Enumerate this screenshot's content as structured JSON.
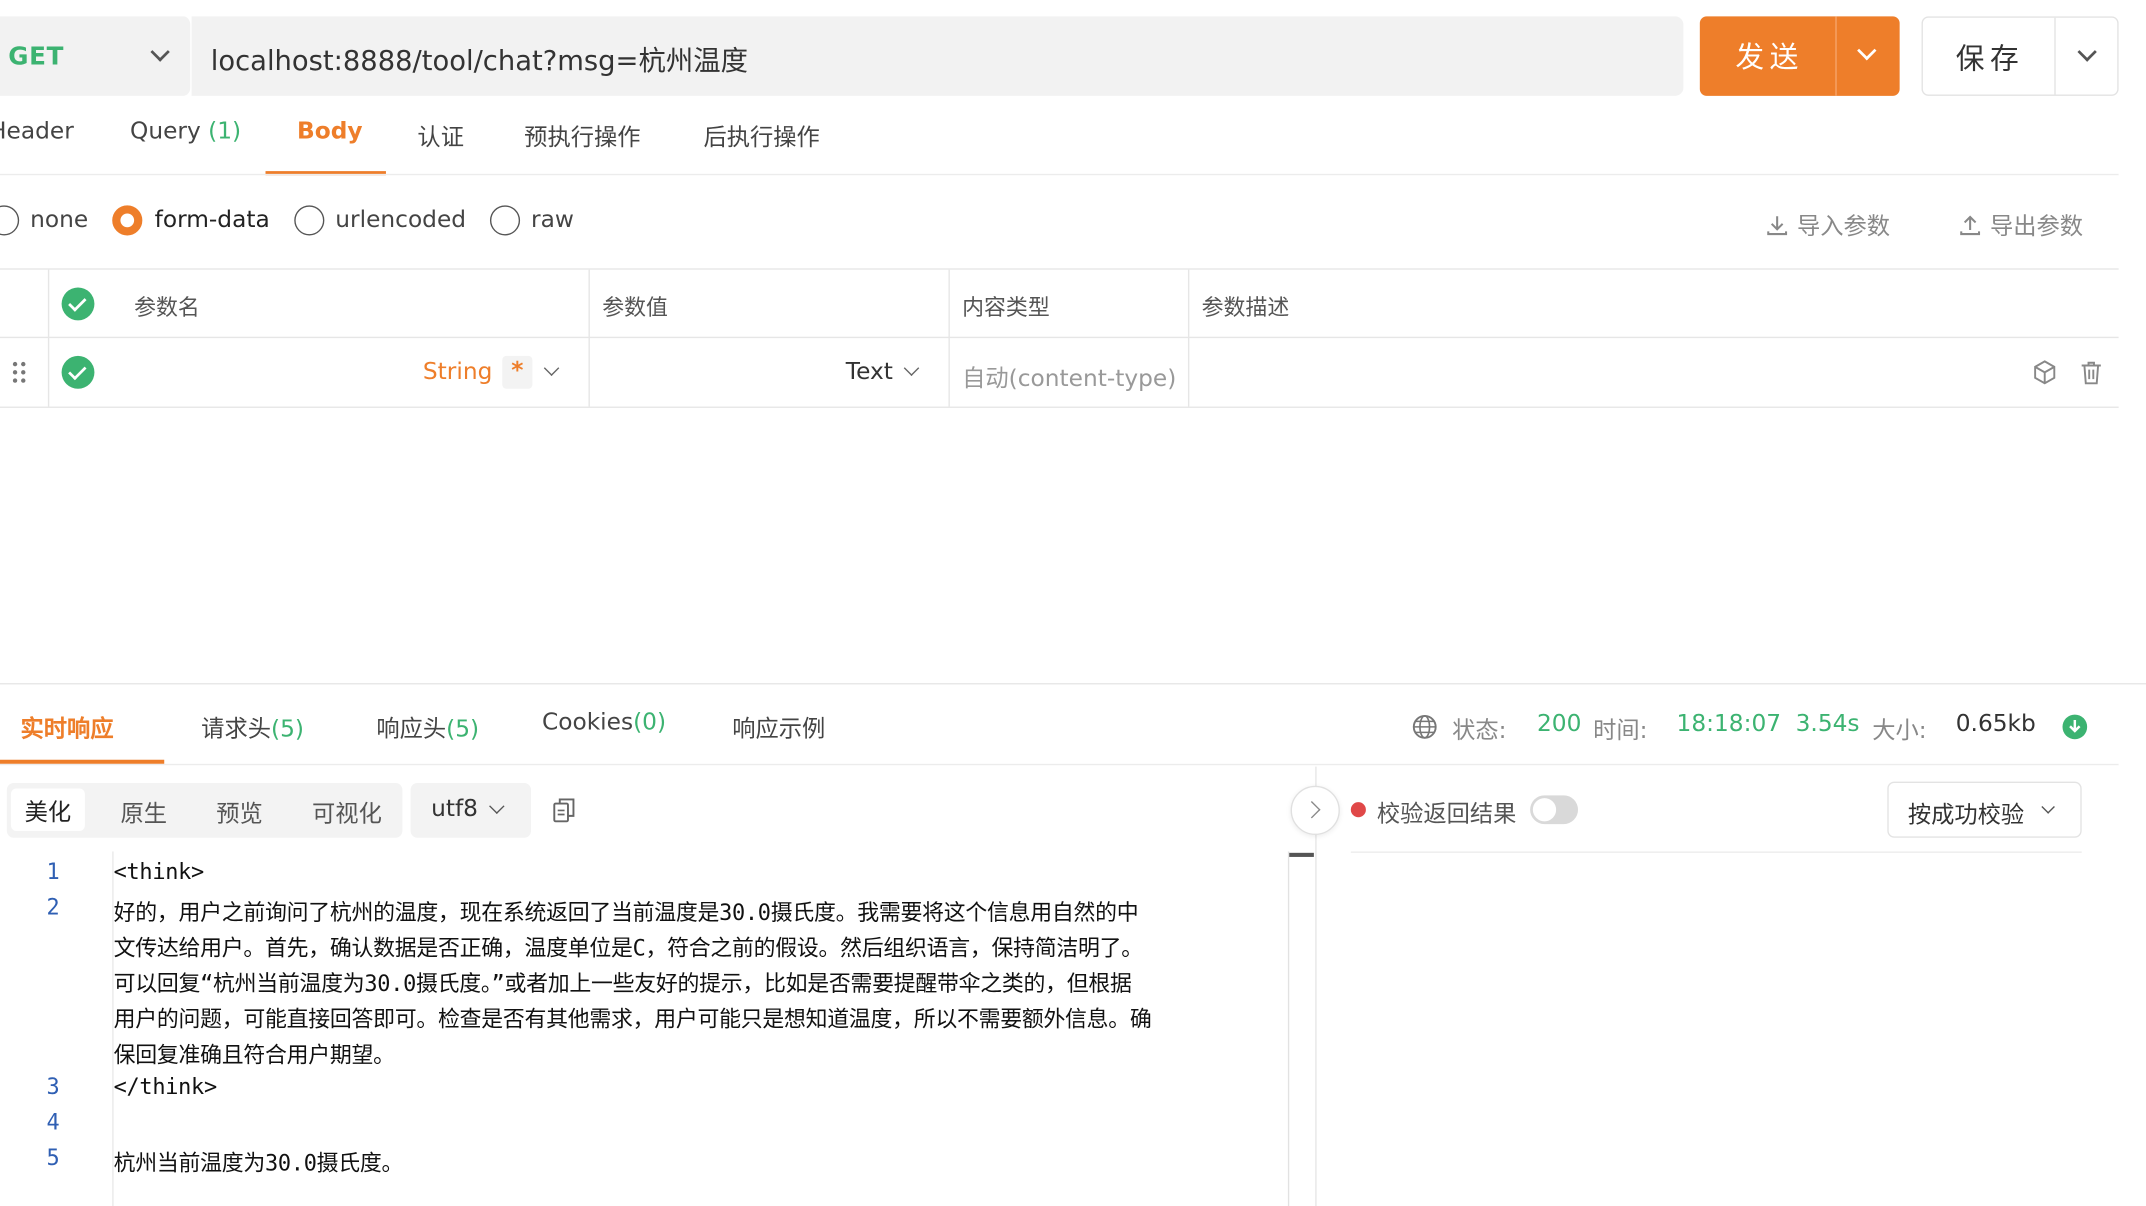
{
  "request": {
    "method": "GET",
    "url": "localhost:8888/tool/chat?msg=杭州温度",
    "send_label": "发送",
    "save_label": "保存"
  },
  "request_tabs": [
    {
      "label": "Header",
      "count": ""
    },
    {
      "label": "Query",
      "count": "(1)"
    },
    {
      "label": "Body",
      "count": ""
    },
    {
      "label": "认证",
      "count": ""
    },
    {
      "label": "预执行操作",
      "count": ""
    },
    {
      "label": "后执行操作",
      "count": ""
    }
  ],
  "body_types": {
    "options": [
      "none",
      "form-data",
      "urlencoded",
      "raw"
    ],
    "selected": "form-data",
    "import_label": "导入参数",
    "export_label": "导出参数"
  },
  "params_table": {
    "headers": [
      "参数名",
      "参数值",
      "内容类型",
      "参数描述"
    ],
    "rows": [
      {
        "name": "",
        "type": "String",
        "required_mark": "*",
        "value_type": "Text",
        "content_type": "自动(content-type)",
        "description": ""
      }
    ]
  },
  "response_tabs": [
    {
      "label": "实时响应",
      "count": ""
    },
    {
      "label": "请求头",
      "count": "(5)"
    },
    {
      "label": "响应头",
      "count": "(5)"
    },
    {
      "label": "Cookies",
      "count": "(0)"
    },
    {
      "label": "响应示例",
      "count": ""
    }
  ],
  "response_status": {
    "status_label": "状态:",
    "status": "200",
    "time_label": "时间:",
    "time": "18:18:07",
    "duration": "3.54s",
    "size_label": "大小:",
    "size": "0.65kb"
  },
  "view_modes": [
    "美化",
    "原生",
    "预览",
    "可视化"
  ],
  "encoding": "utf8",
  "verify": {
    "label": "校验返回结果",
    "mode": "按成功校验"
  },
  "code_lines": [
    {
      "num": "1",
      "lines": [
        "<think>"
      ]
    },
    {
      "num": "2",
      "lines": [
        "好的，用户之前询问了杭州的温度，现在系统返回了当前温度是30.0摄氏度。我需要将这个信息用自然的中",
        "文传达给用户。首先，确认数据是否正确，温度单位是C，符合之前的假设。然后组织语言，保持简洁明了。",
        "可以回复“杭州当前温度为30.0摄氏度。”或者加上一些友好的提示，比如是否需要提醒带伞之类的，但根据",
        "用户的问题，可能直接回答即可。检查是否有其他需求，用户可能只是想知道温度，所以不需要额外信息。确",
        "保回复准确且符合用户期望。"
      ]
    },
    {
      "num": "3",
      "lines": [
        "</think>"
      ]
    },
    {
      "num": "4",
      "lines": [
        ""
      ]
    },
    {
      "num": "5",
      "lines": [
        "杭州当前温度为30.0摄氏度。"
      ]
    }
  ],
  "colors": {
    "accent": "#ee7e2a",
    "success": "#3cb371",
    "error_dot": "#e04848"
  }
}
